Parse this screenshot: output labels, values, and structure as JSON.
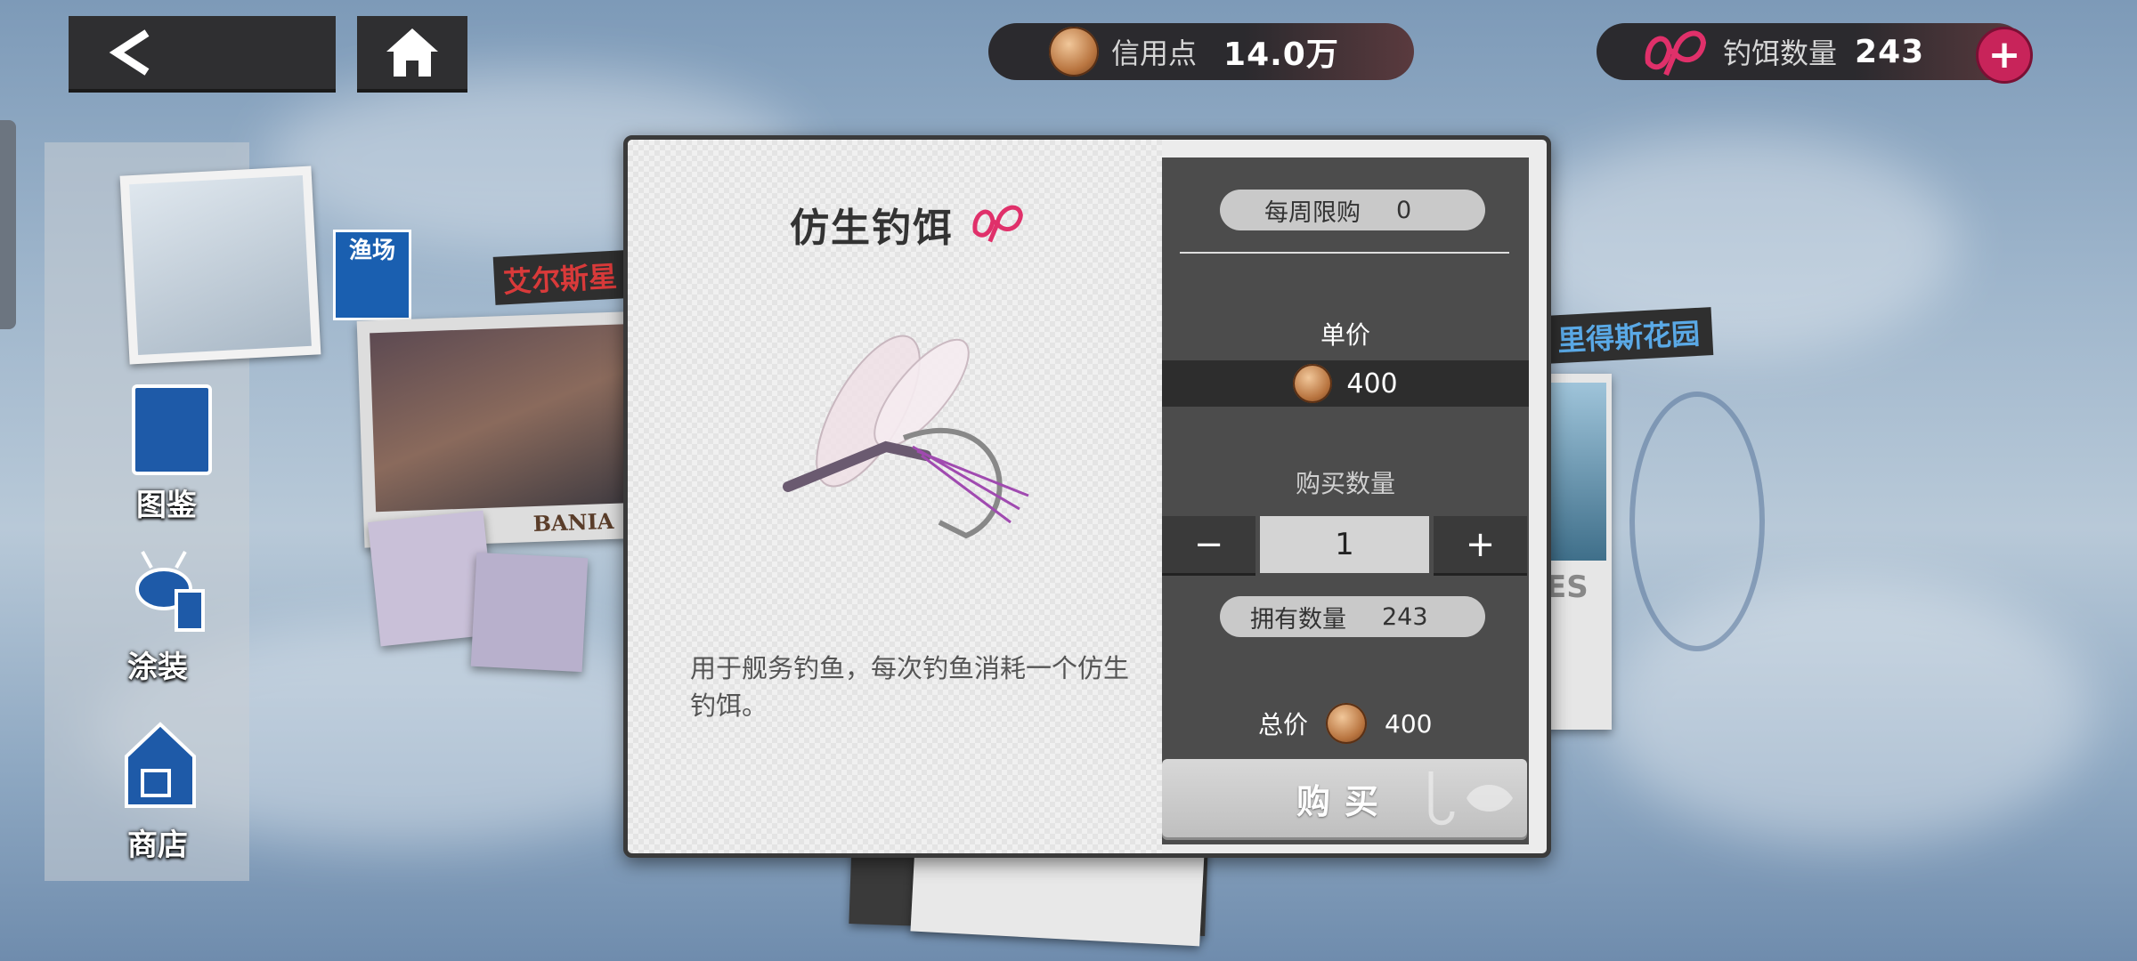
{
  "header": {
    "credits": {
      "label": "信用点",
      "value": "14.0万",
      "icon": "credit-coin-icon"
    },
    "bait": {
      "label": "钓饵数量",
      "value": "243",
      "icon": "bait-icon"
    }
  },
  "sidebar": {
    "items": [
      {
        "label": "图鉴",
        "icon": "fish-book-icon"
      },
      {
        "label": "涂装",
        "icon": "paint-bug-icon"
      },
      {
        "label": "商店",
        "icon": "shop-house-icon"
      }
    ],
    "fishing_spot_badge": "渔场"
  },
  "background": {
    "left_card_title": "艾尔斯星",
    "left_card_caption": "BANIA",
    "right_card_title": "里得斯花园",
    "right_card_caption": "ES"
  },
  "item": {
    "name": "仿生钓饵",
    "description": "用于舰务钓鱼，每次钓鱼消耗一个仿生钓饵。"
  },
  "purchase": {
    "weekly_limit_label": "每周限购",
    "weekly_limit_value": "0",
    "unit_price_label": "单价",
    "unit_price_value": "400",
    "quantity_label": "购买数量",
    "quantity_value": "1",
    "minus": "−",
    "plus": "+",
    "owned_label": "拥有数量",
    "owned_value": "243",
    "total_label": "总价",
    "total_value": "400",
    "buy_label": "购买"
  },
  "colors": {
    "accent": "#e0306a",
    "panel": "#4c4c4c"
  }
}
